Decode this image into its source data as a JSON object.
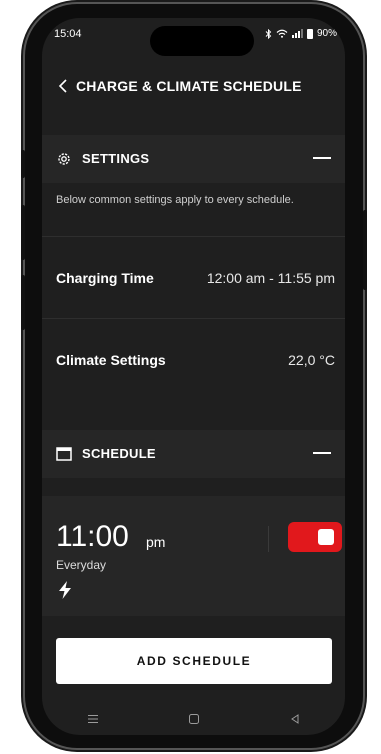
{
  "status_bar": {
    "time": "15:04",
    "battery": "90%",
    "icons": [
      "bluetooth-icon",
      "wifi-icon",
      "signal-icon",
      "battery-icon"
    ]
  },
  "header": {
    "title": "CHARGE & CLIMATE SCHEDULE",
    "back_icon": "chevron-left-icon"
  },
  "settings": {
    "title": "SETTINGS",
    "icon": "gear-icon",
    "description": "Below common settings apply to every schedule.",
    "rows": [
      {
        "label": "Charging Time",
        "value": "12:00 am - 11:55 pm"
      },
      {
        "label": "Climate Settings",
        "value": "22,0 °C"
      }
    ]
  },
  "schedule": {
    "title": "SCHEDULE",
    "icon": "calendar-icon",
    "item": {
      "time": "11:00",
      "ampm": "pm",
      "repeat": "Everyday",
      "type_icon": "lightning-bolt-icon",
      "enabled": true
    }
  },
  "add_button_label": "ADD SCHEDULE",
  "nav_bar": {
    "icons": [
      "menu-icon",
      "home-icon",
      "back-icon"
    ]
  },
  "colors": {
    "accent": "#e1181c",
    "background": "#1f1f1f",
    "section": "#262626"
  }
}
